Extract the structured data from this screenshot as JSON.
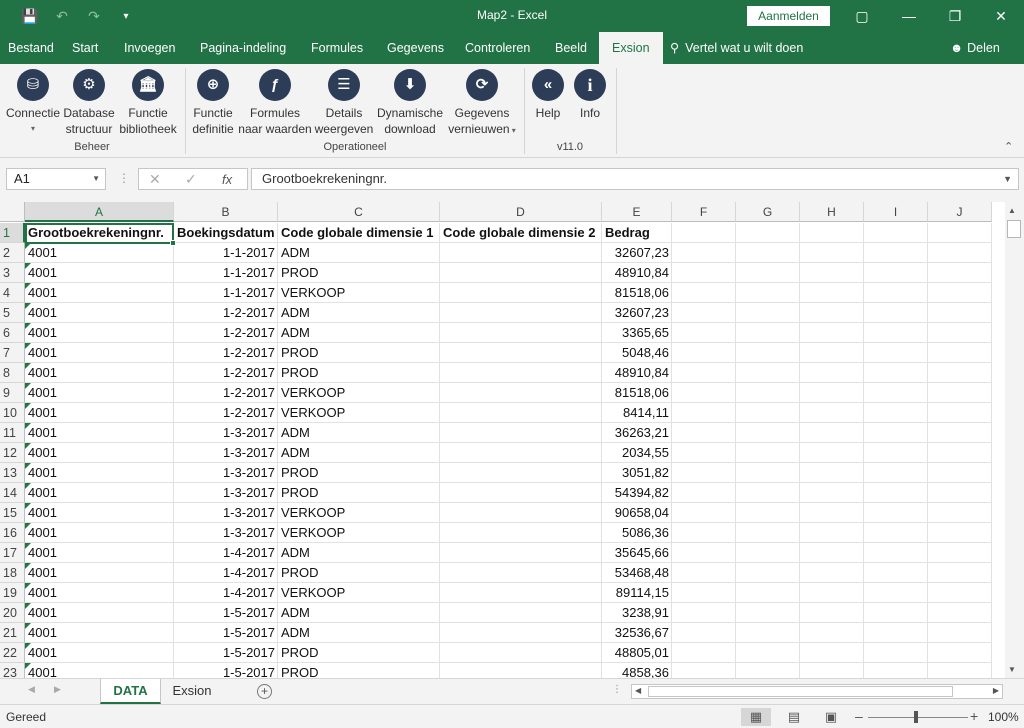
{
  "window": {
    "title": "Map2  -  Excel",
    "signin_label": "Aanmelden"
  },
  "tabs": [
    "Bestand",
    "Start",
    "Invoegen",
    "Pagina-indeling",
    "Formules",
    "Gegevens",
    "Controleren",
    "Beeld",
    "Exsion"
  ],
  "active_tab": "Exsion",
  "tell_me": "Vertel wat u wilt doen",
  "share_label": "Delen",
  "ribbon": {
    "beheer": {
      "label": "Beheer",
      "buttons": [
        {
          "line1": "Connectie",
          "line2": "",
          "icon": "database-plus-icon"
        },
        {
          "line1": "Database",
          "line2": "structuur",
          "icon": "database-gear-icon"
        },
        {
          "line1": "Functie",
          "line2": "bibliotheek",
          "icon": "library-icon"
        }
      ]
    },
    "operationeel": {
      "label": "Operationeel",
      "buttons": [
        {
          "line1": "Functie",
          "line2": "definitie",
          "icon": "crosshair-icon"
        },
        {
          "line1": "Formules",
          "line2": "naar waarden",
          "icon": "formula-icon"
        },
        {
          "line1": "Details",
          "line2": "weergeven",
          "icon": "details-icon"
        },
        {
          "line1": "Dynamische",
          "line2": "download",
          "icon": "download-icon"
        },
        {
          "line1": "Gegevens",
          "line2": "vernieuwen",
          "icon": "refresh-icon"
        }
      ]
    },
    "version": {
      "label": "v11.0",
      "buttons": [
        {
          "line1": "Help",
          "line2": "",
          "icon": "help-icon"
        },
        {
          "line1": "Info",
          "line2": "",
          "icon": "info-icon"
        }
      ]
    }
  },
  "formula_bar": {
    "name_box": "A1",
    "fx_label": "fx",
    "content": "Grootboekrekeningnr."
  },
  "columns": [
    "A",
    "B",
    "C",
    "D",
    "E",
    "F",
    "G",
    "H",
    "I",
    "J"
  ],
  "header_row": [
    "Grootboekrekeningnr.",
    "Boekingsdatum",
    "Code globale dimensie 1",
    "Code globale dimensie 2",
    "Bedrag"
  ],
  "rows": [
    [
      "4001",
      "1-1-2017",
      "ADM",
      "",
      "32607,23"
    ],
    [
      "4001",
      "1-1-2017",
      "PROD",
      "",
      "48910,84"
    ],
    [
      "4001",
      "1-1-2017",
      "VERKOOP",
      "",
      "81518,06"
    ],
    [
      "4001",
      "1-2-2017",
      "ADM",
      "",
      "32607,23"
    ],
    [
      "4001",
      "1-2-2017",
      "ADM",
      "",
      "3365,65"
    ],
    [
      "4001",
      "1-2-2017",
      "PROD",
      "",
      "5048,46"
    ],
    [
      "4001",
      "1-2-2017",
      "PROD",
      "",
      "48910,84"
    ],
    [
      "4001",
      "1-2-2017",
      "VERKOOP",
      "",
      "81518,06"
    ],
    [
      "4001",
      "1-2-2017",
      "VERKOOP",
      "",
      "8414,11"
    ],
    [
      "4001",
      "1-3-2017",
      "ADM",
      "",
      "36263,21"
    ],
    [
      "4001",
      "1-3-2017",
      "ADM",
      "",
      "2034,55"
    ],
    [
      "4001",
      "1-3-2017",
      "PROD",
      "",
      "3051,82"
    ],
    [
      "4001",
      "1-3-2017",
      "PROD",
      "",
      "54394,82"
    ],
    [
      "4001",
      "1-3-2017",
      "VERKOOP",
      "",
      "90658,04"
    ],
    [
      "4001",
      "1-3-2017",
      "VERKOOP",
      "",
      "5086,36"
    ],
    [
      "4001",
      "1-4-2017",
      "ADM",
      "",
      "35645,66"
    ],
    [
      "4001",
      "1-4-2017",
      "PROD",
      "",
      "53468,48"
    ],
    [
      "4001",
      "1-4-2017",
      "VERKOOP",
      "",
      "89114,15"
    ],
    [
      "4001",
      "1-5-2017",
      "ADM",
      "",
      "3238,91"
    ],
    [
      "4001",
      "1-5-2017",
      "ADM",
      "",
      "32536,67"
    ],
    [
      "4001",
      "1-5-2017",
      "PROD",
      "",
      "48805,01"
    ],
    [
      "4001",
      "1-5-2017",
      "PROD",
      "",
      "4858,36"
    ]
  ],
  "sheets": [
    "DATA",
    "Exsion"
  ],
  "active_sheet": "DATA",
  "status": {
    "ready": "Gereed",
    "zoom": "100%"
  },
  "colors": {
    "accent": "#217346",
    "icon_bg": "#2e3d57"
  }
}
